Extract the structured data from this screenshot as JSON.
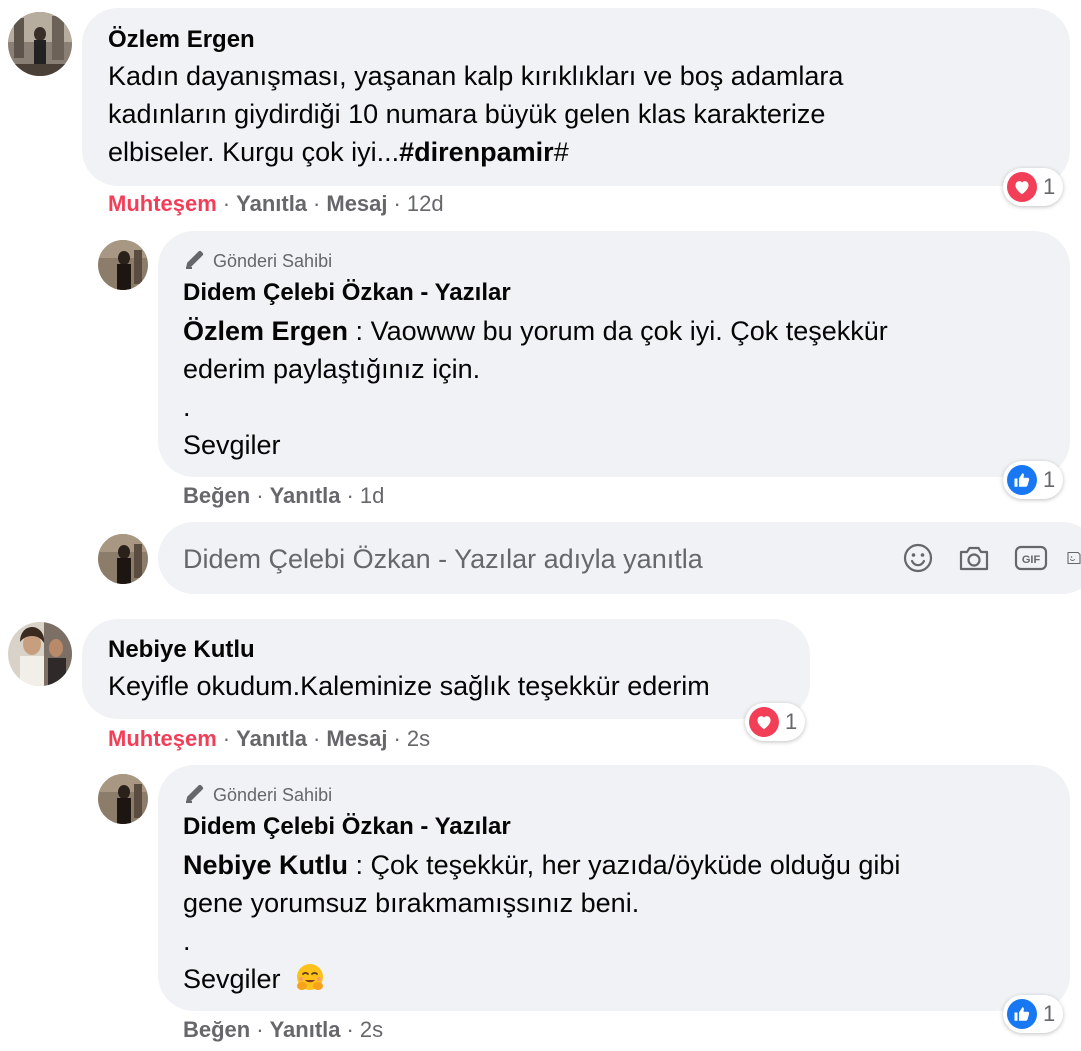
{
  "comments": [
    {
      "author": "Özlem Ergen",
      "lines": [
        "Kadın dayanışması, yaşanan kalp kırıklıkları ve boş adamlara",
        "kadınların giydirdiği 10 numara büyük gelen klas karakterize",
        "elbiseler. Kurgu çok iyi..."
      ],
      "hashtag": "#direnpamir",
      "hashtag_tail": "#",
      "reaction_label": "Muhteşem",
      "reply_label": "Yanıtla",
      "message_label": "Mesaj",
      "time": "12d",
      "reaction_count": "1"
    },
    {
      "author": "Nebiye Kutlu",
      "lines": [
        "Keyifle okudum.Kaleminize sağlık teşekkür ederim"
      ],
      "reaction_label": "Muhteşem",
      "reply_label": "Yanıtla",
      "message_label": "Mesaj",
      "time": "2s",
      "reaction_count": "1"
    }
  ],
  "replies": [
    {
      "owner_tag": "Gönderi Sahibi",
      "author": "Didem Çelebi Özkan - Yazılar",
      "mention": "Özlem Ergen",
      "separator": " : ",
      "line1_rest": "Vaowww bu yorum da çok iyi. Çok teşekkür",
      "line2": "ederim paylaştığınız için.",
      "line3": ".",
      "line4": "Sevgiler",
      "like_label": "Beğen",
      "reply_label": "Yanıtla",
      "time": "1d",
      "reaction_count": "1"
    },
    {
      "owner_tag": "Gönderi Sahibi",
      "author": "Didem Çelebi Özkan - Yazılar",
      "mention": "Nebiye Kutlu",
      "separator": " : ",
      "line1_rest": "Çok teşekkür, her yazıda/öyküde olduğu gibi",
      "line2": "gene yorumsuz bırakmamışsınız beni.",
      "line3": ".",
      "line4": "Sevgiler",
      "like_label": "Beğen",
      "reply_label": "Yanıtla",
      "time": "2s",
      "reaction_count": "1"
    }
  ],
  "reply_input": {
    "placeholder": "Didem Çelebi Özkan - Yazılar adıyla yanıtla"
  },
  "icons": {
    "reaction_love": "heart-icon",
    "reaction_like": "thumbs-up-icon",
    "owner": "pen-icon",
    "emoji": "smiley-icon",
    "camera": "camera-icon",
    "gif": "gif-icon",
    "sticker": "sticker-icon",
    "hug_emoji": "hug-emoji-icon"
  },
  "colors": {
    "bubble": "#f0f2f5",
    "love_red": "#f33e58",
    "like_blue": "#1877f2",
    "secondary_text": "#65676b"
  }
}
